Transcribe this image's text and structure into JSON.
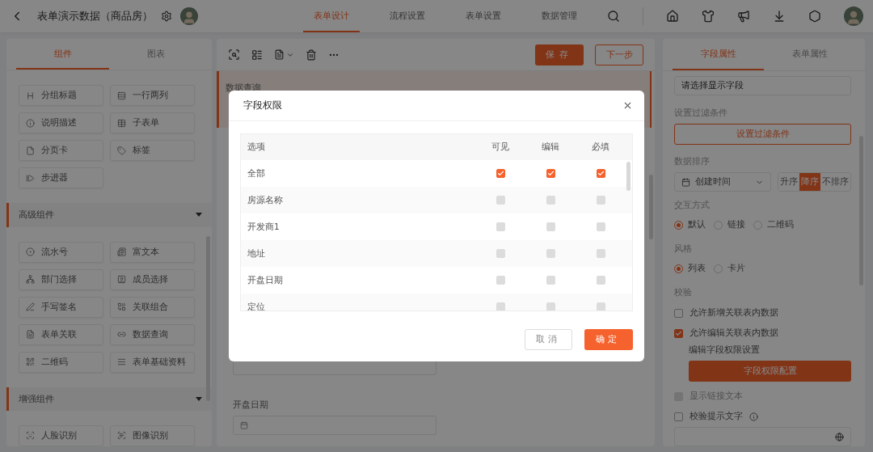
{
  "header": {
    "title": "表单演示数据（商品房）",
    "nav": [
      {
        "label": "表单设计",
        "selected": true
      },
      {
        "label": "流程设置",
        "selected": false
      },
      {
        "label": "表单设置",
        "selected": false
      },
      {
        "label": "数据管理",
        "selected": false
      }
    ]
  },
  "left_panel": {
    "tabs": [
      {
        "label": "组件",
        "selected": true
      },
      {
        "label": "图表",
        "selected": false
      }
    ],
    "basic_components": [
      "分组标题",
      "一行两列",
      "说明描述",
      "子表单",
      "分页卡",
      "标签",
      "步进器"
    ],
    "sections": [
      {
        "title": "高级组件",
        "expanded": true,
        "items": [
          "流水号",
          "富文本",
          "部门选择",
          "成员选择",
          "手写签名",
          "关联组合",
          "表单关联",
          "数据查询",
          "二维码",
          "表单基础资料"
        ]
      },
      {
        "title": "增强组件",
        "expanded": true,
        "items": [
          "人脸识别",
          "图像识别"
        ]
      }
    ]
  },
  "canvas": {
    "save": "保存",
    "next": "下一步",
    "fields": [
      {
        "kind": "selected",
        "label": "数据查询"
      },
      {
        "kind": "input"
      },
      {
        "kind": "date",
        "label": "开盘日期"
      }
    ]
  },
  "right_panel": {
    "tabs": [
      {
        "label": "字段属性",
        "selected": true
      },
      {
        "label": "表单属性",
        "selected": false
      }
    ],
    "display_field": {
      "value": "请选择显示字段"
    },
    "filter": {
      "label": "设置过滤条件",
      "button": "设置过滤条件"
    },
    "sort": {
      "label": "数据排序",
      "field": "创建时间",
      "orders": [
        {
          "label": "升序",
          "selected": false
        },
        {
          "label": "降序",
          "selected": true
        },
        {
          "label": "不排序",
          "selected": false
        }
      ]
    },
    "interaction": {
      "label": "交互方式",
      "options": [
        {
          "label": "默认",
          "selected": true
        },
        {
          "label": "链接",
          "selected": false
        },
        {
          "label": "二维码",
          "selected": false
        }
      ]
    },
    "style": {
      "label": "风格",
      "options": [
        {
          "label": "列表",
          "selected": true
        },
        {
          "label": "卡片",
          "selected": false
        }
      ]
    },
    "validation": {
      "label": "校验",
      "checks": [
        {
          "label": "允许新增关联表内数据",
          "checked": false,
          "disabled": false,
          "info": false
        },
        {
          "label": "允许编辑关联表内数据",
          "checked": true,
          "disabled": false,
          "info": false
        }
      ],
      "sub_label": "编辑字段权限设置",
      "button": "字段权限配置",
      "more_checks": [
        {
          "label": "显示链接文本",
          "checked": false,
          "disabled": true,
          "info": false
        },
        {
          "label": "校验提示文字",
          "checked": false,
          "disabled": false,
          "info": true
        }
      ]
    }
  },
  "dialog": {
    "title": "字段权限",
    "columns": [
      "选项",
      "可见",
      "编辑",
      "必填"
    ],
    "rows": [
      {
        "label": "全部",
        "cells": [
          {
            "checked": true,
            "disabled": false
          },
          {
            "checked": true,
            "disabled": false
          },
          {
            "checked": true,
            "disabled": false
          }
        ]
      },
      {
        "label": "房源名称",
        "cells": [
          {
            "checked": false,
            "disabled": true
          },
          {
            "checked": false,
            "disabled": true
          },
          {
            "checked": false,
            "disabled": true
          }
        ]
      },
      {
        "label": "开发商1",
        "cells": [
          {
            "checked": false,
            "disabled": true
          },
          {
            "checked": false,
            "disabled": true
          },
          {
            "checked": false,
            "disabled": true
          }
        ]
      },
      {
        "label": "地址",
        "cells": [
          {
            "checked": false,
            "disabled": true
          },
          {
            "checked": false,
            "disabled": true
          },
          {
            "checked": false,
            "disabled": true
          }
        ]
      },
      {
        "label": "开盘日期",
        "cells": [
          {
            "checked": false,
            "disabled": true
          },
          {
            "checked": false,
            "disabled": true
          },
          {
            "checked": false,
            "disabled": true
          }
        ]
      },
      {
        "label": "定位",
        "cells": [
          {
            "checked": false,
            "disabled": true
          },
          {
            "checked": false,
            "disabled": true
          },
          {
            "checked": false,
            "disabled": true
          }
        ]
      }
    ],
    "cancel": "取消",
    "ok": "确定"
  }
}
